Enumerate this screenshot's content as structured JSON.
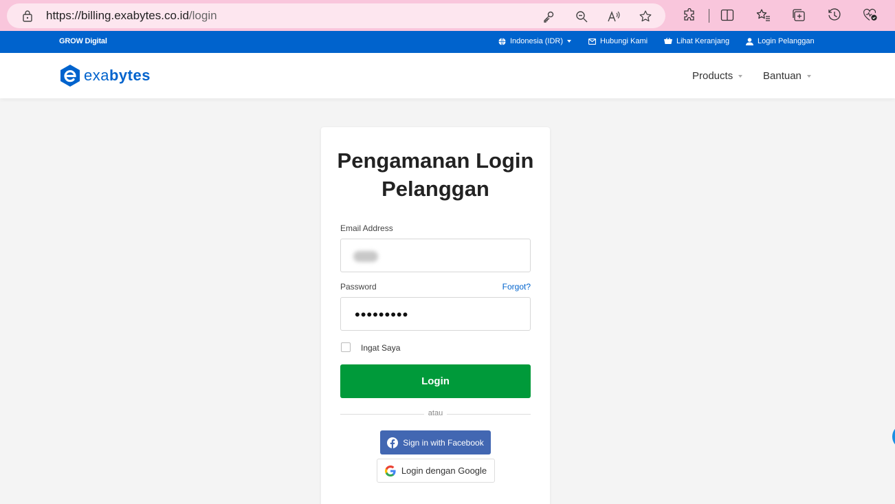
{
  "browser": {
    "url_host": "https://billing.exabytes.co.id",
    "url_path": "/login",
    "colors": {
      "chrome": "#f9c6dc",
      "pill": "#fde6ef"
    }
  },
  "topbar": {
    "brand": "GROW Digital",
    "region": "Indonesia (IDR)",
    "contact": "Hubungi Kami",
    "cart": "Lihat Keranjang",
    "login": "Login Pelanggan",
    "color": "#0063cd"
  },
  "header": {
    "logo_prefix": "exa",
    "logo_suffix": "bytes",
    "nav": [
      {
        "label": "Products"
      },
      {
        "label": "Bantuan"
      }
    ]
  },
  "login_card": {
    "title": "Pengamanan Login Pelanggan",
    "email_label": "Email Address",
    "password_label": "Password",
    "forgot": "Forgot?",
    "password_mask": "•••••••••",
    "remember": "Ingat Saya",
    "submit": "Login",
    "divider": "atau",
    "facebook": "Sign in with Facebook",
    "google": "Login dengan Google",
    "colors": {
      "login_button": "#009a3a",
      "facebook": "#4267b2",
      "link": "#0063cd"
    }
  }
}
